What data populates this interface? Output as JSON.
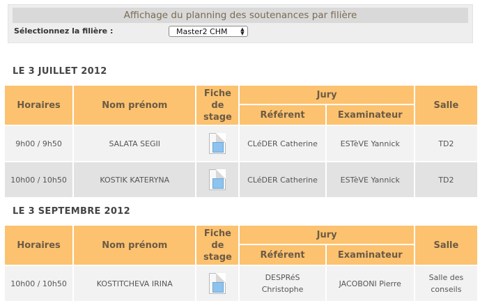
{
  "header": {
    "title": "Affichage du planning des soutenances par filière",
    "filter_label": "Sélectionnez la filière :",
    "filter_value": "Master2 CHM"
  },
  "columns": {
    "horaires": "Horaires",
    "nom": "Nom prénom",
    "fiche_line1": "Fiche",
    "fiche_line2": "de",
    "fiche_line3": "stage",
    "jury": "Jury",
    "referent": "Référent",
    "examinateur": "Examinateur",
    "salle": "Salle"
  },
  "icons": {
    "fiche": "document-icon"
  },
  "colors": {
    "header_bg": "#fcc26f",
    "row_odd": "#f2f2f2",
    "row_even": "#e2e2e2"
  },
  "sections": [
    {
      "title": "LE 3 JUILLET 2012",
      "rows": [
        {
          "horaire": "9h00 / 9h50",
          "nom": "SALATA SEGII",
          "referent": "CLéDER Catherine",
          "examinateur": "ESTèVE Yannick",
          "salle": "TD2"
        },
        {
          "horaire": "10h00 / 10h50",
          "nom": "KOSTIK KATERYNA",
          "referent": "CLéDER Catherine",
          "examinateur": "ESTèVE Yannick",
          "salle": "TD2"
        }
      ]
    },
    {
      "title": "LE 3 SEPTEMBRE 2012",
      "rows": [
        {
          "horaire": "10h00 / 10h50",
          "nom": "KOSTITCHEVA IRINA",
          "referent_line1": "DESPRéS",
          "referent_line2": "Christophe",
          "examinateur": "JACOBONI Pierre",
          "salle_line1": "Salle des",
          "salle_line2": "conseils"
        }
      ]
    }
  ]
}
